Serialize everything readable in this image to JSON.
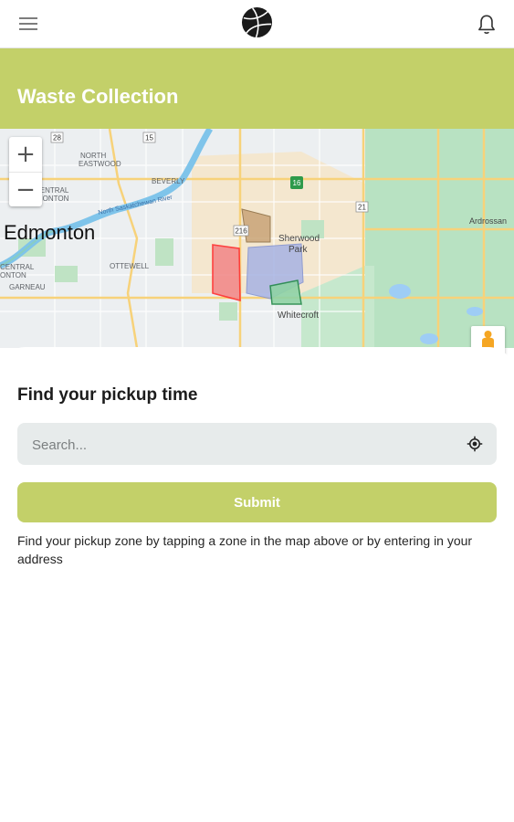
{
  "header": {
    "menu_icon": "hamburger-menu-icon",
    "logo": "basketball-logo",
    "notification_icon": "bell-icon"
  },
  "page": {
    "title": "Waste Collection"
  },
  "map": {
    "city_label": "Edmonton",
    "labels": {
      "north_eastmood": "NORTH\nEASTWOOD",
      "beverly": "BEVERLY",
      "central_mckernan": "CENTRAL\nMONTON",
      "ottewell": "OTTEWELL",
      "central_lower": "CENTRAL\nONTON",
      "garneau": "GARNEAU",
      "sherwood_park": "Sherwood\nPark",
      "whitecroft": "Whitecroft",
      "ardrossan": "Ardrossan",
      "river": "North Saskatchewan River",
      "hwy_28": "28",
      "hwy_15": "15",
      "hwy_16": "16",
      "hwy_21": "21",
      "hwy_216": "216"
    },
    "zoom_in": "+",
    "zoom_out": "−",
    "street_view_icon": "pegman-icon",
    "colors": {
      "zone_red": "#f28b8b",
      "zone_blue": "#a7b3e4",
      "zone_brown": "#c9a477",
      "zone_green": "#8fd3a5"
    }
  },
  "sheet": {
    "heading": "Find your pickup time",
    "search_placeholder": "Search...",
    "locate_icon": "my-location-icon",
    "submit_label": "Submit",
    "helper_text": "Find your pickup zone by tapping a zone in the map above or by entering in your address"
  },
  "colors": {
    "accent": "#c3d069"
  }
}
